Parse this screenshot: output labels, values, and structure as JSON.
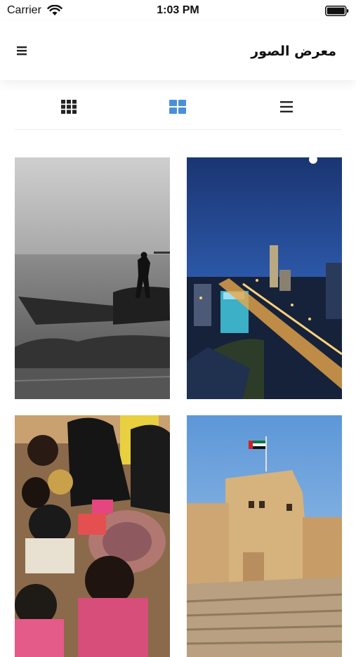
{
  "status_bar": {
    "carrier": "Carrier",
    "time": "1:03 PM",
    "icons": [
      "wifi-icon",
      "battery-icon"
    ]
  },
  "header": {
    "title": "معرض الصور",
    "menu_icon": "hamburger-menu-icon"
  },
  "view_modes": [
    {
      "name": "small-grid",
      "icon": "grid-3x3-icon",
      "active": false
    },
    {
      "name": "large-grid",
      "icon": "grid-2x2-icon",
      "active": true
    },
    {
      "name": "list",
      "icon": "list-icon",
      "active": false
    }
  ],
  "colors": {
    "accent": "#4a90d9",
    "icon": "#222222",
    "divider": "#ececec"
  },
  "photos": [
    {
      "id": "city-night",
      "icon": "photo-icon"
    },
    {
      "id": "fisherman-boat",
      "icon": "photo-icon"
    },
    {
      "id": "fort-flag",
      "icon": "photo-icon"
    },
    {
      "id": "women-weaving",
      "icon": "photo-icon"
    }
  ]
}
